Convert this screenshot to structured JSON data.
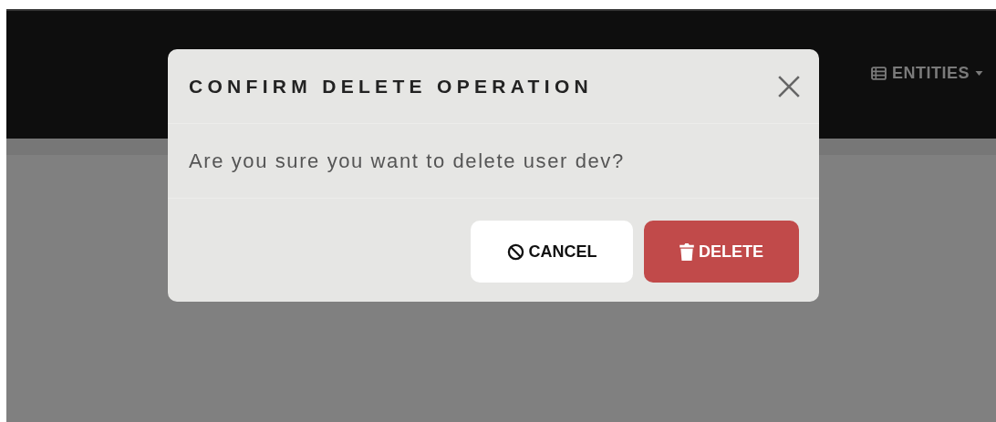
{
  "navbar": {
    "menu": {
      "label": "ENTITIES"
    }
  },
  "dialog": {
    "title": "CONFIRM DELETE OPERATION",
    "message": "Are you sure you want to delete user dev?",
    "buttons": [
      {
        "label": "CANCEL",
        "kind": "cancel"
      },
      {
        "label": "DELETE",
        "kind": "danger"
      }
    ]
  }
}
